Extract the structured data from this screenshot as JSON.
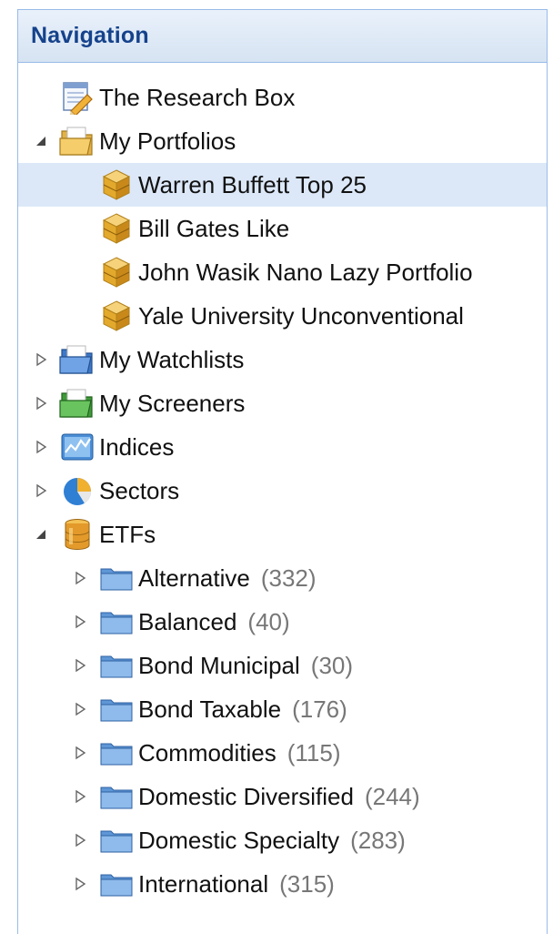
{
  "header": {
    "title": "Navigation"
  },
  "tree": {
    "research_box": {
      "label": "The Research Box"
    },
    "portfolios": {
      "label": "My Portfolios",
      "items": [
        {
          "label": "Warren Buffett Top 25"
        },
        {
          "label": "Bill Gates Like"
        },
        {
          "label": "John Wasik Nano Lazy Portfolio"
        },
        {
          "label": "Yale University Unconventional"
        }
      ]
    },
    "watchlists": {
      "label": "My Watchlists"
    },
    "screeners": {
      "label": "My Screeners"
    },
    "indices": {
      "label": "Indices"
    },
    "sectors": {
      "label": "Sectors"
    },
    "etfs": {
      "label": "ETFs",
      "items": [
        {
          "label": "Alternative",
          "count": "(332)"
        },
        {
          "label": "Balanced",
          "count": "(40)"
        },
        {
          "label": "Bond Municipal",
          "count": "(30)"
        },
        {
          "label": "Bond Taxable",
          "count": "(176)"
        },
        {
          "label": "Commodities",
          "count": "(115)"
        },
        {
          "label": "Domestic Diversified",
          "count": "(244)"
        },
        {
          "label": "Domestic Specialty",
          "count": "(283)"
        },
        {
          "label": "International",
          "count": "(315)"
        }
      ]
    }
  },
  "colors": {
    "header_text": "#15428b",
    "border": "#99bbe8",
    "selected_row": "#dce8f8",
    "count_text": "#777777"
  }
}
